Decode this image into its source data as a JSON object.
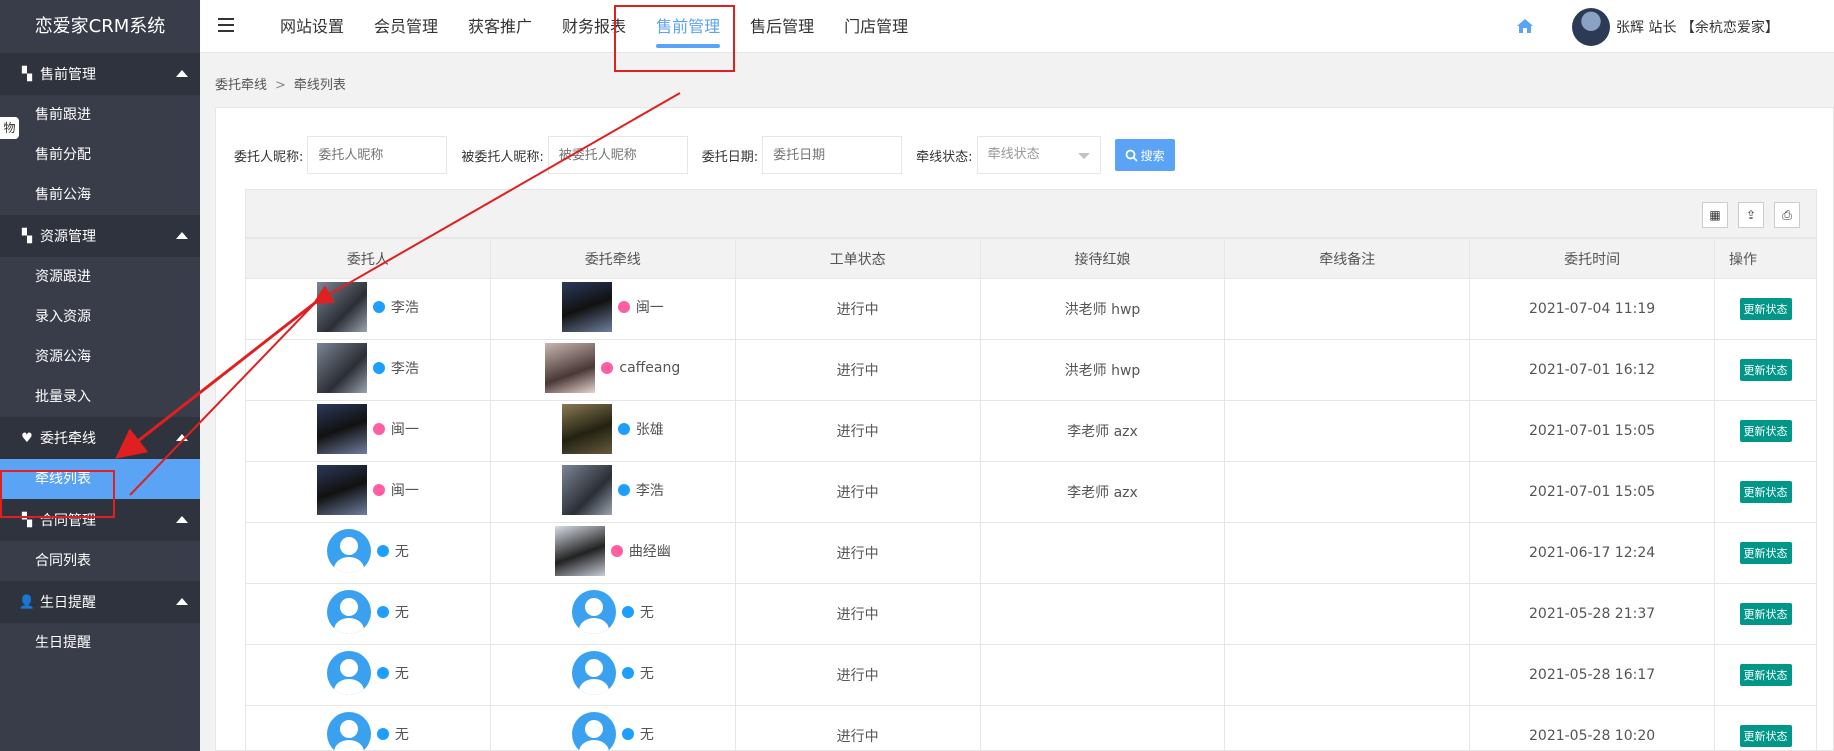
{
  "app": {
    "title": "恋爱家CRM系统"
  },
  "sidebar": {
    "side_tag": "物",
    "groups": [
      {
        "title": "售前管理",
        "icon": "grid-icon",
        "items": [
          "售前跟进",
          "售前分配",
          "售前公海"
        ]
      },
      {
        "title": "资源管理",
        "icon": "grid-icon",
        "items": [
          "资源跟进",
          "录入资源",
          "资源公海",
          "批量录入"
        ]
      },
      {
        "title": "委托牵线",
        "icon": "heart-icon",
        "items": [
          "牵线列表"
        ]
      },
      {
        "title": "合同管理",
        "icon": "grid-icon",
        "items": [
          "合同列表"
        ]
      },
      {
        "title": "生日提醒",
        "icon": "person-icon",
        "items": [
          "生日提醒"
        ]
      }
    ]
  },
  "topnav": {
    "items": [
      "网站设置",
      "会员管理",
      "获客推广",
      "财务报表",
      "售前管理",
      "售后管理",
      "门店管理"
    ],
    "active": "售前管理"
  },
  "user": {
    "name": "张辉 站长 【余杭恋爱家】"
  },
  "breadcrumb": {
    "first": "委托牵线",
    "separator": ">",
    "current": "牵线列表"
  },
  "search": {
    "client_label": "委托人昵称:",
    "client_placeholder": "委托人昵称",
    "target_label": "被委托人昵称:",
    "target_placeholder": "被委托人昵称",
    "date_label": "委托日期:",
    "date_placeholder": "委托日期",
    "status_label": "牵线状态:",
    "status_placeholder": "牵线状态",
    "button": "搜索"
  },
  "table": {
    "headers": [
      "委托人",
      "委托牵线",
      "工单状态",
      "接待红娘",
      "牵线备注",
      "委托时间",
      "操作"
    ],
    "action_label": "更新状态",
    "rows": [
      {
        "client": "李浩",
        "client_gender": "male",
        "client_photo": "photo1",
        "target": "闽一",
        "target_gender": "female",
        "target_photo": "photo2",
        "status": "进行中",
        "matchmaker": "洪老师 hwp",
        "note": "",
        "time": "2021-07-04 11:19"
      },
      {
        "client": "李浩",
        "client_gender": "male",
        "client_photo": "photo1",
        "target": "caffeang",
        "target_gender": "female",
        "target_photo": "photo3",
        "status": "进行中",
        "matchmaker": "洪老师 hwp",
        "note": "",
        "time": "2021-07-01 16:12"
      },
      {
        "client": "闽一",
        "client_gender": "female",
        "client_photo": "photo2",
        "target": "张雄",
        "target_gender": "male",
        "target_photo": "photo4",
        "status": "进行中",
        "matchmaker": "李老师 azx",
        "note": "",
        "time": "2021-07-01 15:05"
      },
      {
        "client": "闽一",
        "client_gender": "female",
        "client_photo": "photo2",
        "target": "李浩",
        "target_gender": "male",
        "target_photo": "photo1",
        "status": "进行中",
        "matchmaker": "李老师 azx",
        "note": "",
        "time": "2021-07-01 15:05"
      },
      {
        "client": "无",
        "client_gender": "male",
        "client_photo": "default",
        "target": "曲经幽",
        "target_gender": "female",
        "target_photo": "photo5",
        "status": "进行中",
        "matchmaker": "",
        "note": "",
        "time": "2021-06-17 12:24"
      },
      {
        "client": "无",
        "client_gender": "male",
        "client_photo": "default",
        "target": "无",
        "target_gender": "male",
        "target_photo": "default",
        "status": "进行中",
        "matchmaker": "",
        "note": "",
        "time": "2021-05-28 21:37"
      },
      {
        "client": "无",
        "client_gender": "male",
        "client_photo": "default",
        "target": "无",
        "target_gender": "male",
        "target_photo": "default",
        "status": "进行中",
        "matchmaker": "",
        "note": "",
        "time": "2021-05-28 16:17"
      },
      {
        "client": "无",
        "client_gender": "male",
        "client_photo": "default",
        "target": "无",
        "target_gender": "male",
        "target_photo": "default",
        "status": "进行中",
        "matchmaker": "",
        "note": "",
        "time": "2021-05-28 10:20"
      }
    ]
  },
  "colors": {
    "accent": "#5ba3f5",
    "sidebar": "#393d49",
    "annotation": "#e02020",
    "action": "#009688"
  }
}
